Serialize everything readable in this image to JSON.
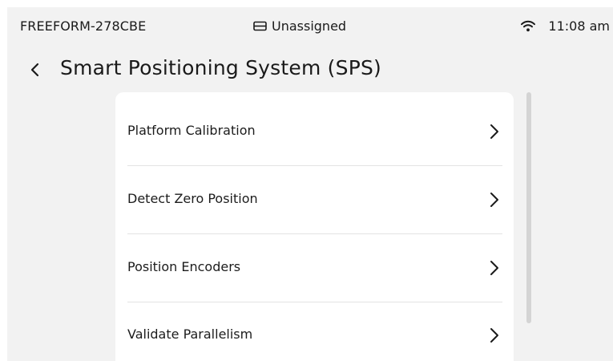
{
  "status_bar": {
    "device_id": "FREEFORM-278CBE",
    "assignment": "Unassigned",
    "time": "11:08 am",
    "assignment_icon": "tray-icon",
    "wifi_icon": "wifi-icon"
  },
  "header": {
    "back_icon": "chevron-left-icon",
    "title": "Smart Positioning System (SPS)"
  },
  "menu": {
    "items": [
      {
        "label": "Platform Calibration"
      },
      {
        "label": "Detect Zero Position"
      },
      {
        "label": "Position Encoders"
      },
      {
        "label": "Validate Parallelism"
      }
    ],
    "item_icon": "chevron-right-icon"
  },
  "colors": {
    "background": "#f2f2f2",
    "card": "#ffffff",
    "text": "#1a1a1a",
    "divider": "#e3e3e3",
    "scrollbar": "#d4d4d4"
  }
}
